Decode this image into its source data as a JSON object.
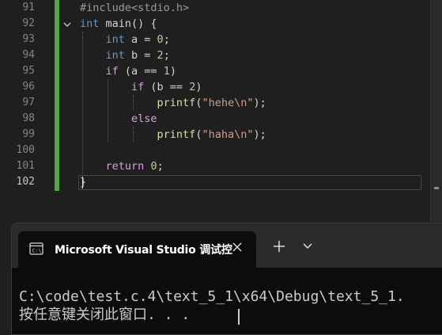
{
  "editor": {
    "lines": [
      {
        "no": "91",
        "tokens": [
          {
            "t": "#include<stdio.h>",
            "c": "pp"
          }
        ]
      },
      {
        "no": "92",
        "tokens": [
          {
            "t": "int",
            "c": "kw"
          },
          {
            "t": " main() {",
            "c": "pl"
          }
        ]
      },
      {
        "no": "93",
        "tokens": [
          {
            "t": "    ",
            "c": "pl"
          },
          {
            "t": "int",
            "c": "kw"
          },
          {
            "t": " a = ",
            "c": "pl"
          },
          {
            "t": "0",
            "c": "num"
          },
          {
            "t": ";",
            "c": "pl"
          }
        ]
      },
      {
        "no": "94",
        "tokens": [
          {
            "t": "    ",
            "c": "pl"
          },
          {
            "t": "int",
            "c": "kw"
          },
          {
            "t": " b = ",
            "c": "pl"
          },
          {
            "t": "2",
            "c": "num"
          },
          {
            "t": ";",
            "c": "pl"
          }
        ]
      },
      {
        "no": "95",
        "tokens": [
          {
            "t": "    ",
            "c": "pl"
          },
          {
            "t": "if",
            "c": "ctl"
          },
          {
            "t": " (a == ",
            "c": "pl"
          },
          {
            "t": "1",
            "c": "num"
          },
          {
            "t": ")",
            "c": "pl"
          }
        ]
      },
      {
        "no": "96",
        "tokens": [
          {
            "t": "        ",
            "c": "pl"
          },
          {
            "t": "if",
            "c": "ctl"
          },
          {
            "t": " (b == ",
            "c": "pl"
          },
          {
            "t": "2",
            "c": "num"
          },
          {
            "t": ")",
            "c": "pl"
          }
        ]
      },
      {
        "no": "97",
        "tokens": [
          {
            "t": "            ",
            "c": "pl"
          },
          {
            "t": "printf",
            "c": "fn"
          },
          {
            "t": "(",
            "c": "pl"
          },
          {
            "t": "\"hehe\\n\"",
            "c": "str"
          },
          {
            "t": ");",
            "c": "pl"
          }
        ]
      },
      {
        "no": "98",
        "tokens": [
          {
            "t": "        ",
            "c": "pl"
          },
          {
            "t": "else",
            "c": "ctl"
          }
        ]
      },
      {
        "no": "99",
        "tokens": [
          {
            "t": "            ",
            "c": "pl"
          },
          {
            "t": "printf",
            "c": "fn"
          },
          {
            "t": "(",
            "c": "pl"
          },
          {
            "t": "\"haha\\n\"",
            "c": "str"
          },
          {
            "t": ");",
            "c": "pl"
          }
        ]
      },
      {
        "no": "100",
        "tokens": []
      },
      {
        "no": "101",
        "tokens": [
          {
            "t": "    ",
            "c": "pl"
          },
          {
            "t": "return",
            "c": "ctl"
          },
          {
            "t": " ",
            "c": "pl"
          },
          {
            "t": "0",
            "c": "num"
          },
          {
            "t": ";",
            "c": "pl"
          }
        ]
      },
      {
        "no": "102",
        "tokens": [
          {
            "t": "}",
            "c": "pl"
          }
        ],
        "active": true
      }
    ]
  },
  "terminal": {
    "tab_title": "Microsoft Visual Studio 调试控",
    "output_line_1": "C:\\code\\test.c.4\\text_5_1\\x64\\Debug\\text_5_1.",
    "output_line_2": "按任意键关闭此窗口. . ."
  },
  "icons": {
    "fold": "chevron-down-icon",
    "terminal": "console-icon",
    "close": "close-icon",
    "new_tab": "plus-icon",
    "dropdown": "chevron-down-icon"
  },
  "colors": {
    "editor_bg": "#1f1f1f",
    "change_bar": "#57a64a",
    "keyword": "#569cd6",
    "control": "#d8a0df",
    "number": "#b5cea8",
    "string": "#d69d85",
    "function": "#dcdcaa",
    "terminal_bg": "#0c0c0c",
    "tabbar_bg": "#2b2b2b"
  }
}
